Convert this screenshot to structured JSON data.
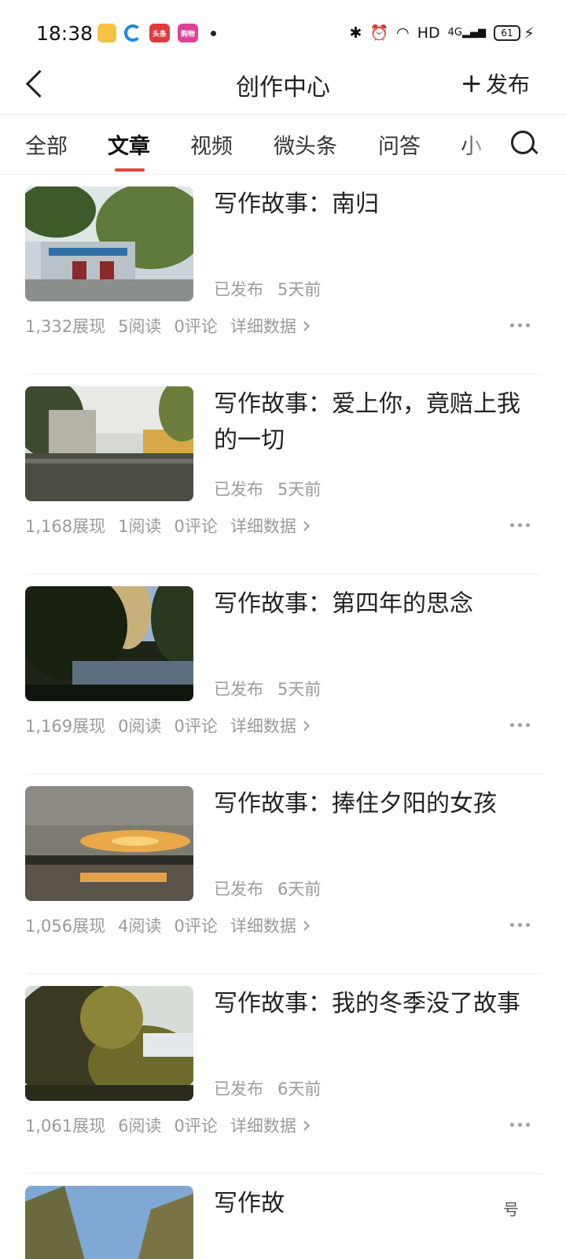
{
  "status_bar": {
    "time": "18:38",
    "app_icons": [
      "notes-app-icon",
      "browser-app-icon",
      "toutiao-app-icon",
      "mall-app-icon"
    ],
    "app_labels": [
      "",
      "",
      "头条",
      "购物"
    ],
    "hd": "HD",
    "network": "4G",
    "battery": "61"
  },
  "header": {
    "title": "创作中心",
    "publish_label": "发布"
  },
  "tabs": [
    {
      "label": "全部",
      "active": false
    },
    {
      "label": "文章",
      "active": true
    },
    {
      "label": "视频",
      "active": false
    },
    {
      "label": "微头条",
      "active": false
    },
    {
      "label": "问答",
      "active": false
    },
    {
      "label": "小",
      "active": false
    }
  ],
  "articles": [
    {
      "title": "写作故事：南归",
      "status": "已发布",
      "time": "5天前",
      "views": "1,332展现",
      "reads": "5阅读",
      "comments": "0评论",
      "detail": "详细数据"
    },
    {
      "title": "写作故事：爱上你，竟赔上我的一切",
      "status": "已发布",
      "time": "5天前",
      "views": "1,168展现",
      "reads": "1阅读",
      "comments": "0评论",
      "detail": "详细数据"
    },
    {
      "title": "写作故事：第四年的思念",
      "status": "已发布",
      "time": "5天前",
      "views": "1,169展现",
      "reads": "0阅读",
      "comments": "0评论",
      "detail": "详细数据"
    },
    {
      "title": "写作故事：捧住夕阳的女孩",
      "status": "已发布",
      "time": "6天前",
      "views": "1,056展现",
      "reads": "4阅读",
      "comments": "0评论",
      "detail": "详细数据"
    },
    {
      "title": "写作故事：我的冬季没了故事",
      "status": "已发布",
      "time": "6天前",
      "views": "1,061展现",
      "reads": "6阅读",
      "comments": "0评论",
      "detail": "详细数据"
    },
    {
      "title": "写作故",
      "status": "",
      "time": "",
      "views": "",
      "reads": "",
      "comments": "",
      "detail": ""
    }
  ],
  "watermark": "号",
  "colors": {
    "accent": "#e6453c",
    "muted_text": "#9a9a9a",
    "title_text": "#222222"
  }
}
